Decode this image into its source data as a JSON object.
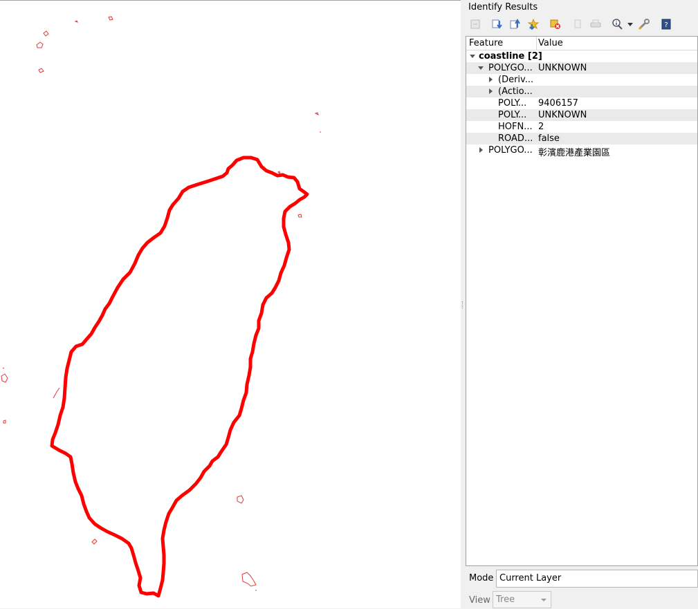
{
  "panel": {
    "title": "Identify Results",
    "toolbar": [
      {
        "icon": "collapse-all-icon"
      },
      {
        "icon": "expand-tree-icon"
      },
      {
        "icon": "collapse-tree-icon"
      },
      {
        "icon": "expand-new-results-icon"
      },
      {
        "icon": "clear-results-icon"
      },
      {
        "icon": "copy-feature-icon"
      },
      {
        "icon": "print-icon"
      },
      {
        "icon": "identify-mode-icon"
      },
      {
        "icon": "dropdown-arrow-icon"
      },
      {
        "icon": "settings-wrench-icon"
      },
      {
        "icon": "help-icon"
      }
    ],
    "columns": {
      "feature": "Feature",
      "value": "Value"
    },
    "rows": [
      {
        "feature": "coastline  [2]",
        "value": "",
        "expanded": true,
        "bold": true
      },
      {
        "feature": "POLYGO...",
        "value": "UNKNOWN",
        "expanded": true
      },
      {
        "feature": "(Deriv...",
        "value": "",
        "expanded": false
      },
      {
        "feature": "(Actio...",
        "value": "",
        "expanded": false
      },
      {
        "feature": "POLY...",
        "value": "9406157"
      },
      {
        "feature": "POLY...",
        "value": "UNKNOWN"
      },
      {
        "feature": "HOFN...",
        "value": "2"
      },
      {
        "feature": "ROAD...",
        "value": "false"
      },
      {
        "feature": "POLYGO...",
        "value": "彰濱鹿港產業園區",
        "expanded": false
      }
    ],
    "mode": {
      "label": "Mode",
      "value": "Current Layer"
    },
    "view": {
      "label": "View",
      "value": "Tree"
    }
  },
  "map": {
    "outline_color": "#ff0000",
    "background": "#ffffff"
  }
}
